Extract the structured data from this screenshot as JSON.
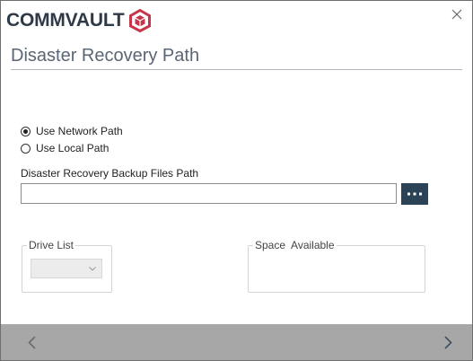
{
  "app": {
    "brand": "COMMVAULT",
    "brand_color": "#2e3a48",
    "accent_color": "#c8344a"
  },
  "header": {
    "title": "Disaster Recovery Path",
    "close_icon": "close-icon"
  },
  "path_type": {
    "options": [
      {
        "label": "Use Network Path",
        "selected": true
      },
      {
        "label": "Use Local Path",
        "selected": false
      }
    ]
  },
  "backup_path": {
    "label": "Disaster Recovery Backup Files Path",
    "value": "",
    "browse_icon": "ellipsis-icon"
  },
  "drive_list": {
    "label": "Drive List",
    "selected": ""
  },
  "space_available": {
    "label": "Space  Available",
    "value": ""
  },
  "footer": {
    "back_icon": "chevron-left-icon",
    "next_icon": "chevron-right-icon",
    "bar_color": "#a7a7a7"
  }
}
